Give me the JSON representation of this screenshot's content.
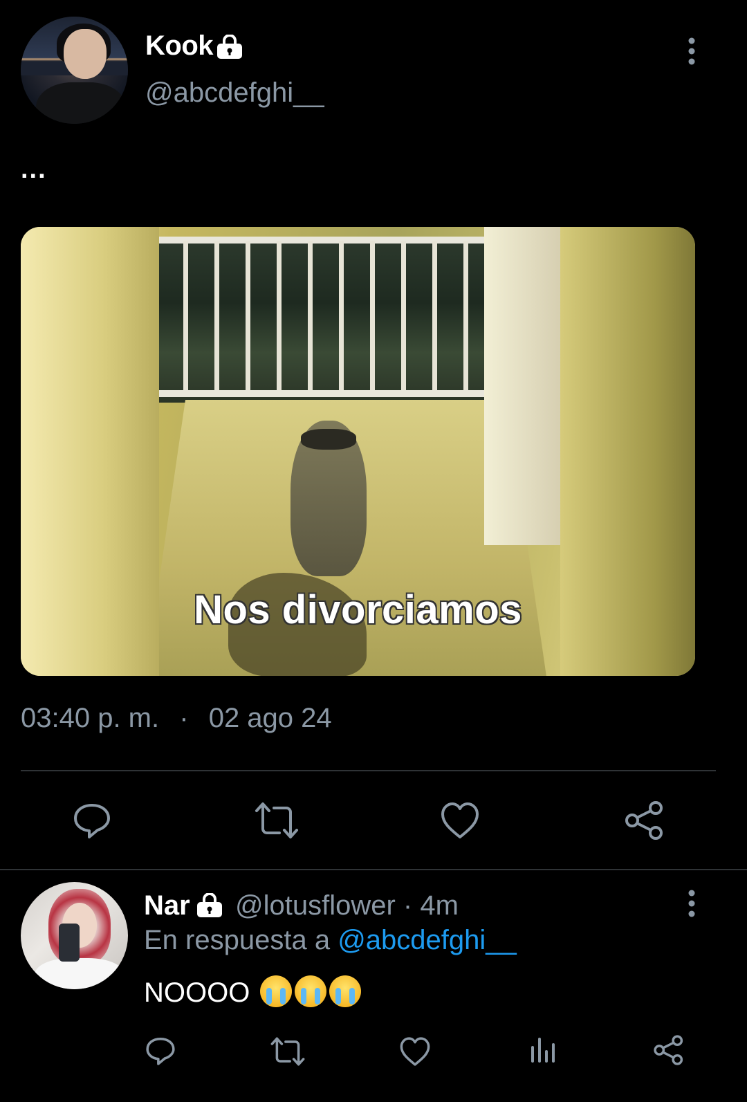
{
  "main_tweet": {
    "name": "Kook",
    "handle": "@abcdefghi__",
    "text": "...",
    "media_caption": "Nos divorciamos",
    "time": "03:40 p. m.",
    "separator": "·",
    "date": "02 ago 24",
    "actions": [
      "reply-icon",
      "retweet-icon",
      "like-icon",
      "share-icon"
    ]
  },
  "reply": {
    "name": "Nar",
    "handle_time": "@lotusflower · 4m",
    "reply_prefix": "En respuesta a ",
    "mention": "@abcdefghi__",
    "text": "NOOOO ",
    "emoji_name": "loudly-crying-face",
    "emoji_count": 3,
    "actions": [
      "reply-icon",
      "retweet-icon",
      "like-icon",
      "views-icon",
      "share-icon"
    ]
  },
  "colors": {
    "background": "#000000",
    "secondary_text": "#8b98a5",
    "mention": "#1d9bf0",
    "divider": "#2f3336",
    "icon": "#8b98a5"
  }
}
